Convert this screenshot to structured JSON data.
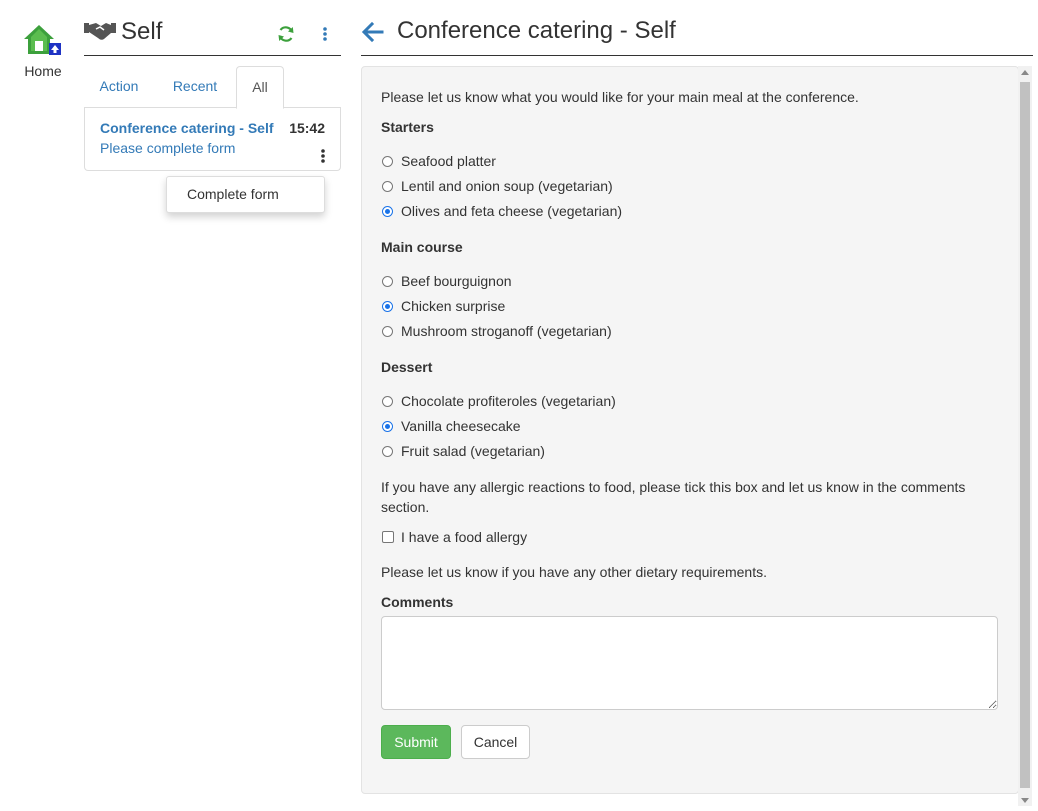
{
  "home": {
    "label": "Home",
    "icon": "home-icon"
  },
  "left": {
    "title": "Self",
    "tabs": [
      {
        "label": "Action"
      },
      {
        "label": "Recent"
      },
      {
        "label": "All"
      }
    ],
    "active_tab": "All",
    "task": {
      "title": "Conference catering - Self",
      "time": "15:42",
      "subtitle": "Please complete form"
    },
    "menu": {
      "items": [
        {
          "label": "Complete form"
        }
      ]
    }
  },
  "form": {
    "title": "Conference catering - Self",
    "intro": "Please let us know what you would like for your main meal at the conference.",
    "sections": [
      {
        "heading": "Starters",
        "options": [
          {
            "label": "Seafood platter",
            "checked": false
          },
          {
            "label": "Lentil and onion soup (vegetarian)",
            "checked": false
          },
          {
            "label": "Olives and feta cheese (vegetarian)",
            "checked": true
          }
        ]
      },
      {
        "heading": "Main course",
        "options": [
          {
            "label": "Beef bourguignon",
            "checked": false
          },
          {
            "label": "Chicken surprise",
            "checked": true
          },
          {
            "label": "Mushroom stroganoff (vegetarian)",
            "checked": false
          }
        ]
      },
      {
        "heading": "Dessert",
        "options": [
          {
            "label": "Chocolate profiteroles (vegetarian)",
            "checked": false
          },
          {
            "label": "Vanilla cheesecake",
            "checked": true
          },
          {
            "label": "Fruit salad (vegetarian)",
            "checked": false
          }
        ]
      }
    ],
    "allergy_text_1": "If you have any allergic reactions to food, please tick this box and let us know in the comments",
    "allergy_text_2": "section.",
    "allergy_checkbox_label": "I have a food allergy",
    "allergy_checked": false,
    "dietary_text": "Please let us know if you have any other dietary requirements.",
    "comments_label": "Comments",
    "comments_value": "",
    "submit_label": "Submit",
    "cancel_label": "Cancel"
  },
  "colors": {
    "link": "#337ab7",
    "home_green": "#3ca03c",
    "submit_green": "#5cb85c",
    "radio_blue": "#1a73e8"
  }
}
